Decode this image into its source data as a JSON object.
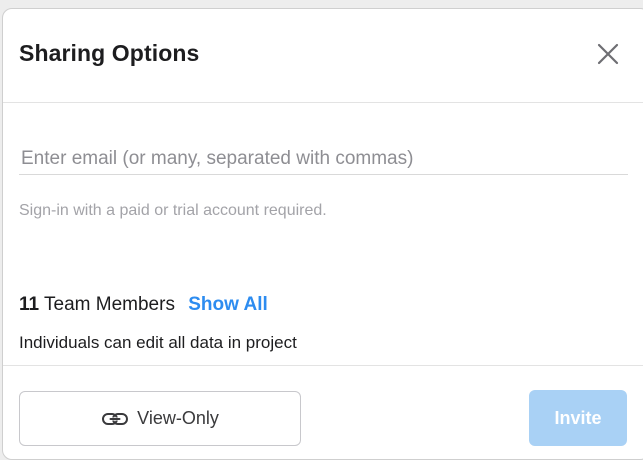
{
  "dialog": {
    "title": "Sharing Options",
    "close_icon": "close-icon"
  },
  "email": {
    "placeholder": "Enter email (or many, separated with commas)",
    "value": "",
    "hint": "Sign-in with a paid or trial account required."
  },
  "team": {
    "count": "11",
    "members_label": "Team Members",
    "show_all_label": "Show All",
    "permission_text": "Individuals can edit all data in project"
  },
  "footer": {
    "view_only_icon": "link-icon",
    "view_only_label": "View-Only",
    "invite_label": "Invite"
  },
  "colors": {
    "accent": "#2d8cf0",
    "invite_disabled_bg": "#a9d1f5",
    "hint_text": "#a3a3a8"
  }
}
